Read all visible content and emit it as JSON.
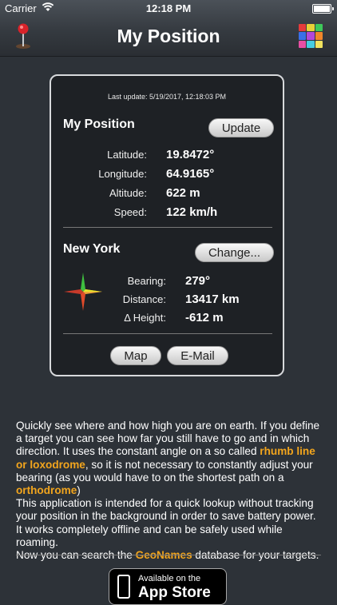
{
  "status_bar": {
    "carrier": "Carrier",
    "time": "12:18 PM"
  },
  "nav": {
    "title": "My Position",
    "left_icon": "pin-icon",
    "right_icon": "color-grid-icon"
  },
  "card": {
    "last_update": "Last update: 5/19/2017, 12:18:03 PM",
    "position": {
      "title": "My Position",
      "update_button": "Update",
      "rows": [
        {
          "label": "Latitude:",
          "value": "19.8472°"
        },
        {
          "label": "Longitude:",
          "value": "64.9165°"
        },
        {
          "label": "Altitude:",
          "value": "622 m"
        },
        {
          "label": "Speed:",
          "value": "122 km/h"
        }
      ]
    },
    "target": {
      "title": "New York",
      "change_button": "Change...",
      "icon": "compass-icon",
      "rows": [
        {
          "label": "Bearing:",
          "value": "279°"
        },
        {
          "label": "Distance:",
          "value": "13417 km"
        },
        {
          "label": "Δ Height:",
          "value": "-612 m"
        }
      ]
    },
    "map_button": "Map",
    "email_button": "E-Mail"
  },
  "description": {
    "p1_a": "Quickly see where and how high you are on earth. If you define a target you can see how far you still have to go and in which direction. It uses the constant angle on a so called ",
    "p1_hl1": "rhumb line or loxodrome",
    "p1_b": ", so it is not necessary to constantly adjust your bearing (as you would have to on the shortest path on a ",
    "p1_hl2": "orthodrome",
    "p1_c": ")",
    "p2": "This application is intended for a quick lookup without tracking your position in the background in order to save battery power. It works completely offline and can be safely used while roaming.",
    "p3_a": "Now you can search the ",
    "p3_hl": "GeoNames",
    "p3_b": " database for your targets."
  },
  "badge": {
    "line1": "Available on the",
    "line2": "App Store",
    "icon": "phone-icon"
  },
  "colors": {
    "accent": "#f2a51d",
    "background": "#2d3238",
    "card": "#1e2125"
  }
}
